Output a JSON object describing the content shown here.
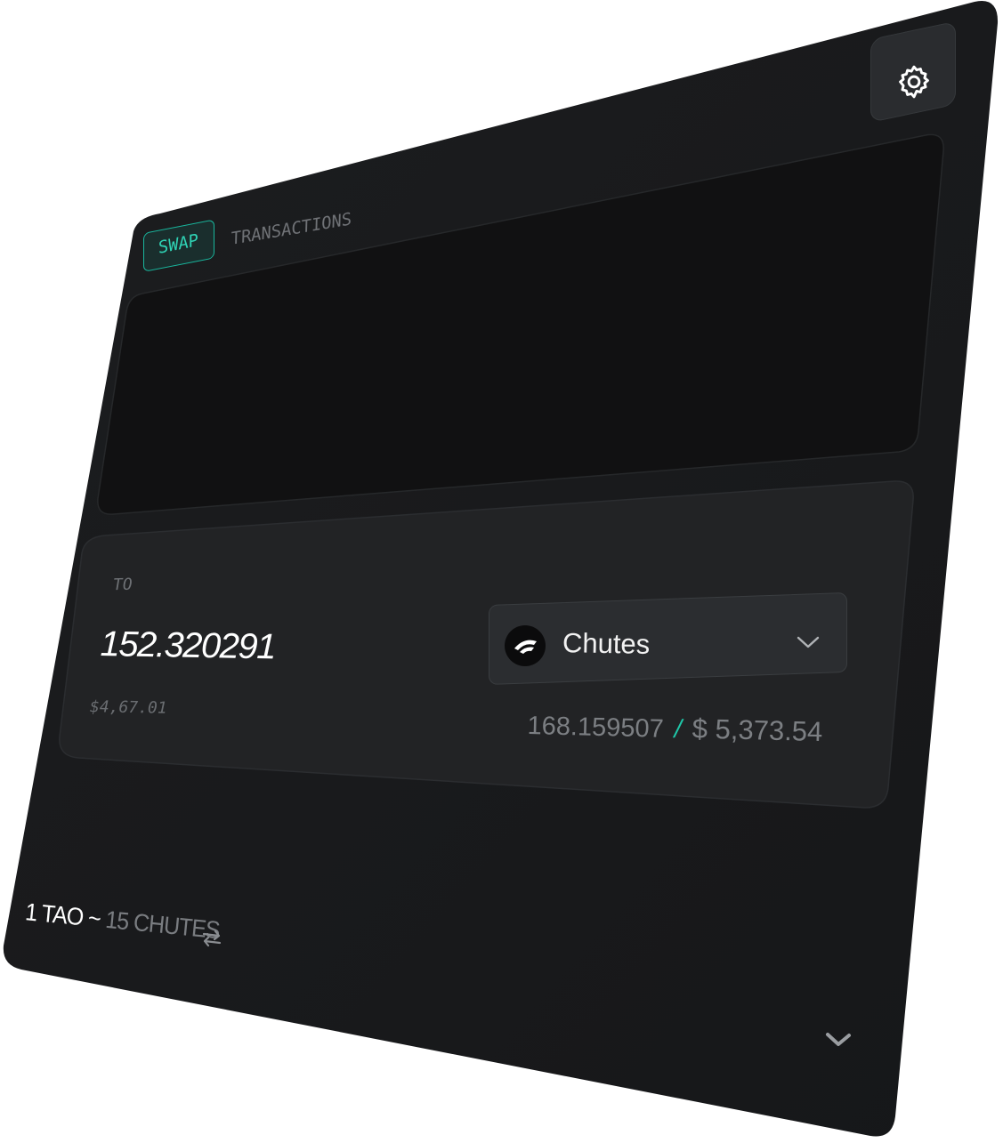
{
  "tabs": [
    {
      "label": "SWAP",
      "active": true
    },
    {
      "label": "TRANSACTIONS",
      "active": false
    }
  ],
  "to_section": {
    "label": "TO",
    "amount": "152.320291",
    "usd_value": "$4,67.01",
    "token": {
      "name": "Chutes",
      "icon": "chutes-logo-icon"
    },
    "balance": "168.159507",
    "balance_separator": "/",
    "balance_usd": "$ 5,373.54"
  },
  "rate": {
    "base": "1 TAO ~",
    "quote": "15 CHUTES"
  },
  "icons": {
    "settings": "gear-icon",
    "dropdown": "chevron-down-icon",
    "swap_direction": "swap-arrows-icon",
    "collapse": "chevron-down-icon"
  },
  "colors": {
    "accent": "#19b69d",
    "panel_bg": "#191a1c",
    "card_bg": "#222325",
    "input_bg": "#111112",
    "text_primary": "#ffffff",
    "text_muted": "#7a7d81"
  }
}
